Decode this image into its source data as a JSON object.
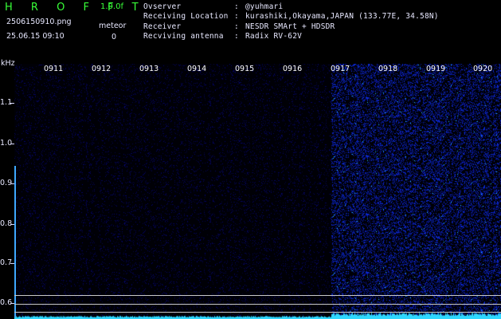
{
  "header": {
    "title": "H R O F F T",
    "version": "1.0.0f",
    "filename": "2506150910.png",
    "datetime": "25.06.15 09:10",
    "meteor_label": "meteor",
    "meteor_count": "0"
  },
  "info": [
    {
      "label": "Ovserver",
      "sep": ":",
      "value": "@yuhmari"
    },
    {
      "label": "Receiving Location",
      "sep": ":",
      "value": "kurashiki,Okayama,JAPAN (133.77E, 34.58N)"
    },
    {
      "label": "Receiver",
      "sep": ":",
      "value": "NESDR SMArt + HDSDR"
    },
    {
      "label": "Recviving antenna",
      "sep": ":",
      "value": "Radix RV-62V"
    }
  ],
  "axis": {
    "unit": "kHz",
    "yticks": [
      "1.1",
      "1.0",
      "0.9",
      "0.8",
      "0.7",
      "0.6"
    ],
    "times": [
      "0911",
      "0912",
      "0913",
      "0914",
      "0915",
      "0916",
      "0917",
      "0918",
      "0919",
      "0920"
    ]
  },
  "colors": {
    "accent": "#38ff38",
    "signal": "#2fd8ff",
    "noise": "#2020c0"
  }
}
